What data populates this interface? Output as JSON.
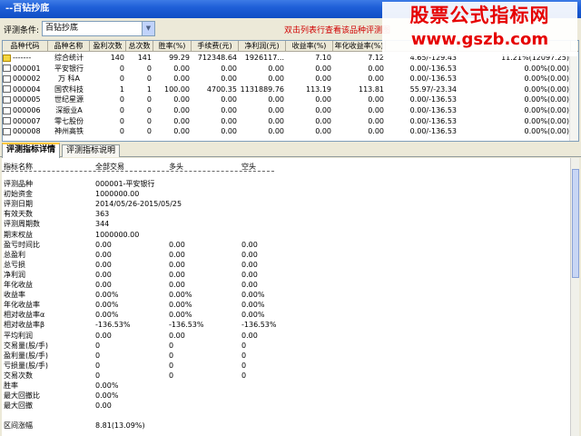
{
  "window": {
    "title": "--百钻抄底"
  },
  "watermark": {
    "line1": "股票公式指标网",
    "line2": "www.gszb.com"
  },
  "filter": {
    "label": "评测条件:",
    "value": "百钻抄底",
    "hint": "双击列表行查看该品种评测图",
    "arrow": "▼"
  },
  "grid": {
    "headers": [
      "品种代码",
      "品种名称",
      "盈利次数",
      "总次数",
      "胜率(%)",
      "手续费(元)",
      "净利润(元)",
      "收益率(%)",
      "年化收益率(%)",
      "",
      ""
    ],
    "rows": [
      [
        "-------",
        "综合统计",
        "140",
        "141",
        "99.29",
        "712348.64",
        "1926117...",
        "7.10",
        "7.12",
        "4.65/-129.43",
        "11.21%(12097.25)"
      ],
      [
        "000001",
        "平安银行",
        "0",
        "0",
        "0.00",
        "0.00",
        "0.00",
        "0.00",
        "0.00",
        "0.00/-136.53",
        "0.00%(0.00)"
      ],
      [
        "000002",
        "万  科A",
        "0",
        "0",
        "0.00",
        "0.00",
        "0.00",
        "0.00",
        "0.00",
        "0.00/-136.53",
        "0.00%(0.00)"
      ],
      [
        "000004",
        "国农科技",
        "1",
        "1",
        "100.00",
        "4700.35",
        "1131889.76",
        "113.19",
        "113.81",
        "55.97/-23.34",
        "0.00%(0.00)"
      ],
      [
        "000005",
        "世纪星源",
        "0",
        "0",
        "0.00",
        "0.00",
        "0.00",
        "0.00",
        "0.00",
        "0.00/-136.53",
        "0.00%(0.00)"
      ],
      [
        "000006",
        "深振业A",
        "0",
        "0",
        "0.00",
        "0.00",
        "0.00",
        "0.00",
        "0.00",
        "0.00/-136.53",
        "0.00%(0.00)"
      ],
      [
        "000007",
        "零七股份",
        "0",
        "0",
        "0.00",
        "0.00",
        "0.00",
        "0.00",
        "0.00",
        "0.00/-136.53",
        "0.00%(0.00)"
      ],
      [
        "000008",
        "神州高铁",
        "0",
        "0",
        "0.00",
        "0.00",
        "0.00",
        "0.00",
        "0.00",
        "0.00/-136.53",
        "0.00%(0.00)"
      ]
    ]
  },
  "tabs": [
    "评测指标详情",
    "评测指标说明"
  ],
  "detail": {
    "header": [
      "指标名称",
      "全部交易",
      "多头",
      "空头"
    ],
    "rows": [
      [
        "评测品种",
        "000001-平安银行",
        "",
        ""
      ],
      [
        "初始资金",
        "1000000.00",
        "",
        ""
      ],
      [
        "评测日期",
        "2014/05/26-2015/05/25",
        "",
        ""
      ],
      [
        "有效天数",
        "363",
        "",
        ""
      ],
      [
        "评测周期数",
        "344",
        "",
        ""
      ],
      [
        "期末权益",
        "1000000.00",
        "",
        ""
      ],
      [
        "盈亏时间比",
        "0.00",
        "0.00",
        "0.00"
      ],
      [
        "总盈利",
        "0.00",
        "0.00",
        "0.00"
      ],
      [
        "总亏损",
        "0.00",
        "0.00",
        "0.00"
      ],
      [
        "净利润",
        "0.00",
        "0.00",
        "0.00"
      ],
      [
        "年化收益",
        "0.00",
        "0.00",
        "0.00"
      ],
      [
        "收益率",
        "0.00%",
        "0.00%",
        "0.00%"
      ],
      [
        "年化收益率",
        "0.00%",
        "0.00%",
        "0.00%"
      ],
      [
        "相对收益率α",
        "0.00%",
        "0.00%",
        "0.00%"
      ],
      [
        "相对收益率β",
        "-136.53%",
        "-136.53%",
        "-136.53%"
      ],
      [
        "平均利润",
        "0.00",
        "0.00",
        "0.00"
      ],
      [
        "交易量(股/手)",
        "0",
        "0",
        "0"
      ],
      [
        "盈利量(股/手)",
        "0",
        "0",
        "0"
      ],
      [
        "亏损量(股/手)",
        "0",
        "0",
        "0"
      ],
      [
        "交易次数",
        "0",
        "0",
        "0"
      ],
      [
        "胜率",
        "0.00%",
        "",
        ""
      ],
      [
        "最大回撤比",
        "0.00%",
        "",
        ""
      ],
      [
        "最大回撤",
        "0.00",
        "",
        ""
      ],
      [
        "",
        "",
        "",
        ""
      ],
      [
        "区间涨幅",
        "8.81(13.09%)",
        "",
        ""
      ]
    ]
  }
}
